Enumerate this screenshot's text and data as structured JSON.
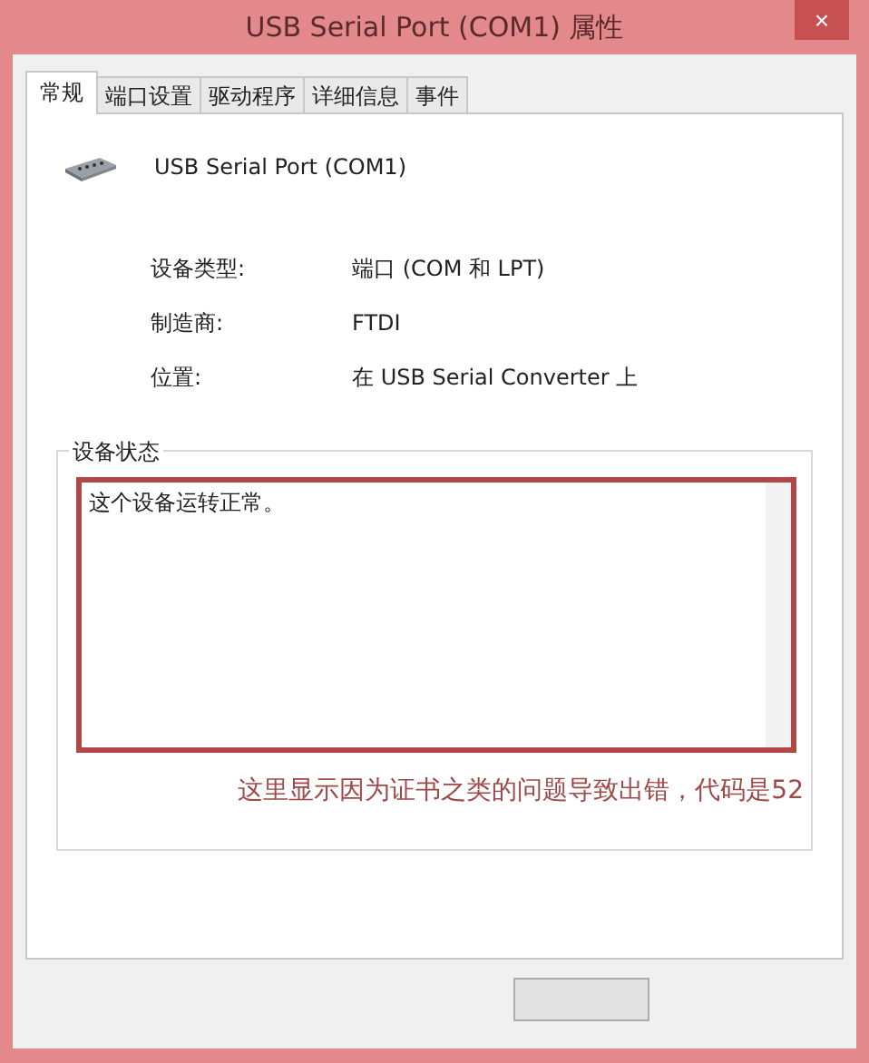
{
  "window": {
    "title": "USB Serial Port (COM1) 属性",
    "close": "×"
  },
  "tabs": [
    {
      "label": "常规",
      "selected": true
    },
    {
      "label": "端口设置",
      "selected": false
    },
    {
      "label": "驱动程序",
      "selected": false
    },
    {
      "label": "详细信息",
      "selected": false
    },
    {
      "label": "事件",
      "selected": false
    }
  ],
  "device_name": "USB Serial Port (COM1)",
  "properties": [
    {
      "label": "设备类型:",
      "value": "端口 (COM 和 LPT)"
    },
    {
      "label": "制造商:",
      "value": "FTDI"
    },
    {
      "label": "位置:",
      "value": "在 USB Serial Converter 上"
    }
  ],
  "device_status": {
    "title": "设备状态",
    "text": "这个设备运转正常。"
  },
  "annotation": "这里显示因为证书之类的问题导致出错，代码是52"
}
